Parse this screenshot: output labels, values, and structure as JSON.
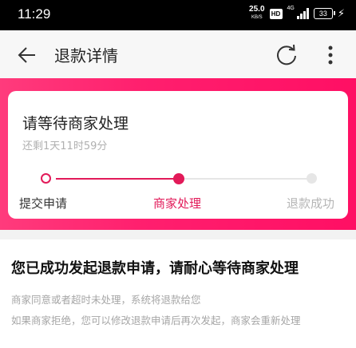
{
  "status_bar": {
    "time": "11:29",
    "speed_value": "25.0",
    "speed_unit": "KB/S",
    "hd": "HD",
    "network": "4G",
    "battery": "33"
  },
  "header": {
    "title": "退款详情",
    "icons": [
      "back-arrow-icon",
      "refresh-icon",
      "more-icon"
    ]
  },
  "progress_card": {
    "title": "请等待商家处理",
    "time_left": "还剩1天11时59分",
    "steps": [
      {
        "label": "提交申请",
        "state": "done"
      },
      {
        "label": "商家处理",
        "state": "current"
      },
      {
        "label": "退款成功",
        "state": "pending"
      }
    ]
  },
  "info": {
    "headline": "您已成功发起退款申请，请耐心等待商家处理",
    "line1": "商家同意或者超时未处理，系统将退款给您",
    "line2": "如果商家拒绝，您可以修改退款申请后再次发起，商家会重新处理"
  },
  "colors": {
    "accent": "#e21a59",
    "hero_gradient_start": "#ff3b7c",
    "hero_gradient_end": "#ff0f64",
    "inactive": "#e6e6e6",
    "muted_text": "#a6a6a6"
  }
}
